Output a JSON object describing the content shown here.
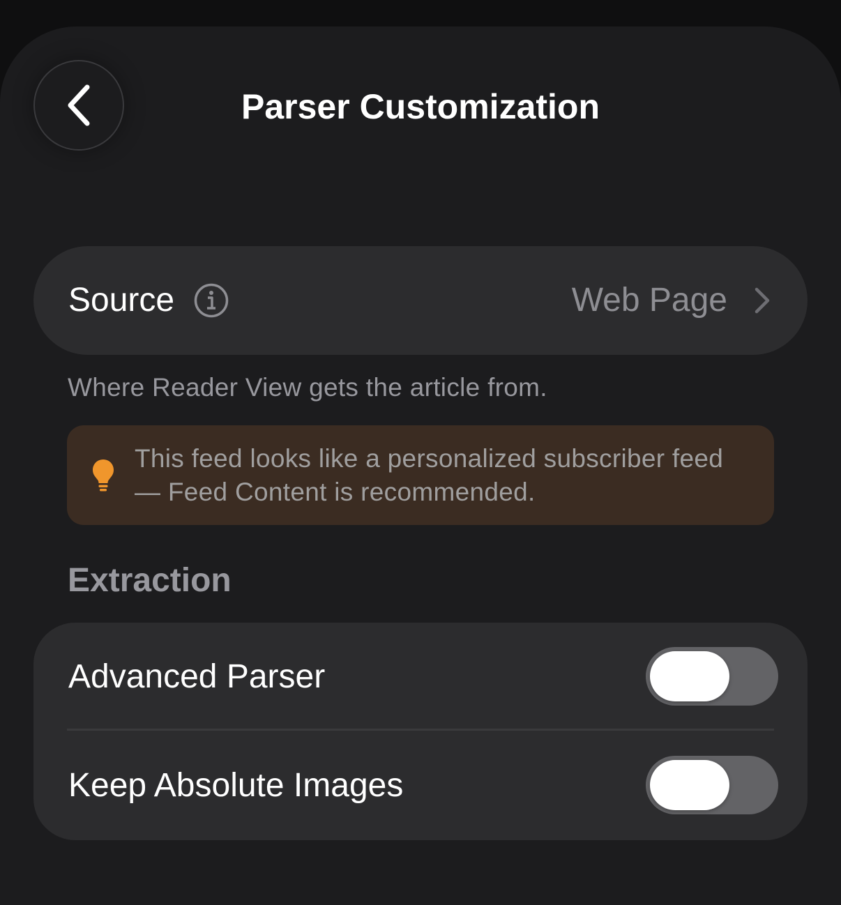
{
  "header": {
    "title": "Parser Customization",
    "back_icon": "chevron-left-icon"
  },
  "source": {
    "label": "Source",
    "info_icon": "info-circle-icon",
    "value": "Web Page",
    "chevron_icon": "chevron-right-icon",
    "footer": "Where Reader View gets the article from."
  },
  "tip": {
    "icon": "lightbulb-icon",
    "text": "This feed looks like a personalized subscriber feed — Feed Content is recommended.",
    "icon_color": "#f0962c",
    "background": "#3b2c22"
  },
  "extraction": {
    "header": "Extraction",
    "rows": [
      {
        "label": "Advanced Parser",
        "enabled": false
      },
      {
        "label": "Keep Absolute Images",
        "enabled": false
      }
    ]
  },
  "colors": {
    "background": "#1c1c1e",
    "cell": "#2c2c2e",
    "secondary_text": "#8e8e93",
    "toggle_off": "#636366"
  }
}
